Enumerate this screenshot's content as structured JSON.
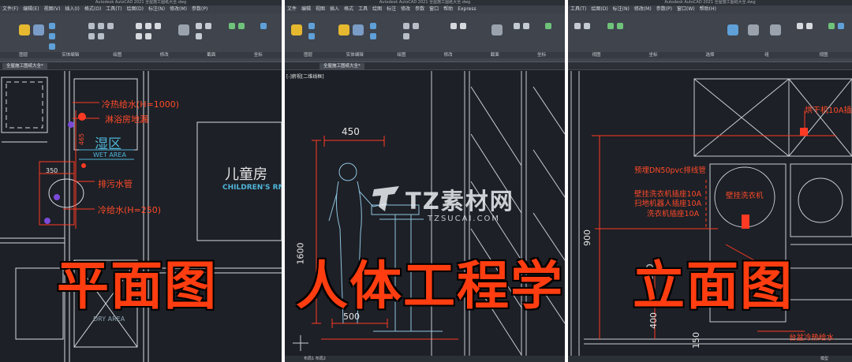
{
  "panels": [
    {
      "app_title": "Autodesk AutoCAD 2021   全屋施工图纸大全.dwg",
      "menu": [
        "文件(F)",
        "编辑(E)",
        "视图(V)",
        "插入(I)",
        "格式(O)",
        "工具(T)",
        "绘图(D)",
        "标注(N)",
        "修改(M)",
        "参数(P)"
      ],
      "ribbon_groups": [
        "图层",
        "实体编辑",
        "绘图",
        "修改",
        "截面",
        "坐标"
      ],
      "doc_tab": "全屋施工图纸大全*",
      "labels": {
        "cold_hot_water": "冷热给水(H=1000)",
        "shower_drain": "淋浴房地漏",
        "wet_area_cn": "湿区",
        "wet_area_en": "WET AREA",
        "dim_350": "350",
        "sewage_pipe": "排污水管",
        "cold_water": "冷给水(H=250)",
        "dim_465": "465",
        "kids_room_cn": "儿童房",
        "kids_room_en": "CHILDREN'S RM",
        "dry_area_en": "DRY AREA"
      },
      "caption": "平面图"
    },
    {
      "app_title": "Autodesk AutoCAD 2021   全屋施工图纸大全.dwg",
      "menu": [
        "文件",
        "编辑",
        "视图",
        "插入",
        "格式",
        "工具",
        "绘图",
        "标注",
        "修改",
        "参数",
        "窗口",
        "帮助",
        "Express"
      ],
      "ribbon_groups": [
        "图层",
        "实体编辑",
        "绘图",
        "修改",
        "截面",
        "坐标"
      ],
      "doc_tab": "全屋施工图纸大全*",
      "viewport_label": "[-]俯视[二维线框]",
      "labels": {
        "dim_450": "450",
        "dim_1600": "1600",
        "dim_500": "500"
      },
      "caption": "人体工程学",
      "bottom_tabs": "布局1   布局2"
    },
    {
      "app_title": "Autodesk AutoCAD 2021   全屋施工图纸大全.dwg",
      "menu": [
        "工具(T)",
        "绘图(D)",
        "标注(N)",
        "修改(M)",
        "参数(P)",
        "窗口(W)",
        "帮助(H)"
      ],
      "ribbon_groups": [
        "视图",
        "坐标",
        "选择",
        "组",
        "视图"
      ],
      "doc_tab": "",
      "labels": {
        "dryer_socket": "烘干机10A插",
        "dn50_pipe": "预埋DN50pvc排线管",
        "wall_washer": "壁挂洗衣机",
        "wall_washer_socket": "壁挂洗衣机插座10A",
        "robot_socket": "扫地机器人插座10A",
        "washer_socket": "洗衣机插座10A",
        "dim_900": "900",
        "dim_1100": "1100",
        "dim_400": "400",
        "dim_150": "150",
        "basin_water": "台盆冷热给水"
      },
      "caption": "立面图",
      "bottom_tabs": "模型"
    }
  ],
  "watermark": {
    "brand": "TZ素材网",
    "url": "TZSUCAI.COM"
  },
  "colors": {
    "accent_red": "#ff3d10",
    "cad_red": "#ff4a2a",
    "cad_cyan": "#4fb4d8",
    "cad_bg": "#1d2026",
    "ribbon_bg": "#3f444d"
  }
}
